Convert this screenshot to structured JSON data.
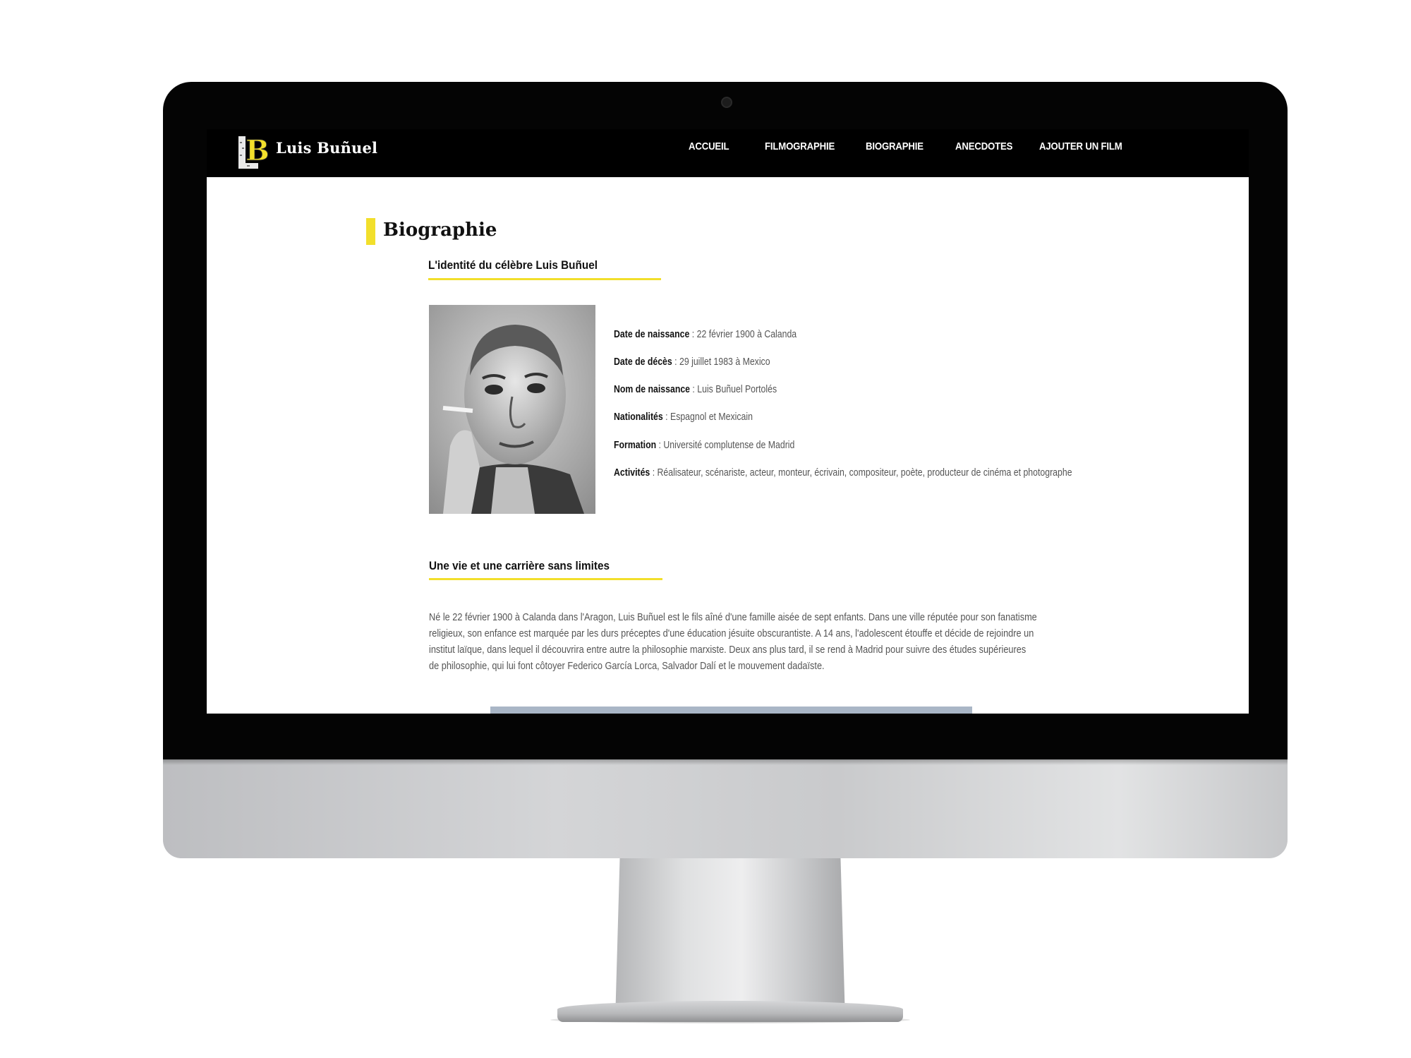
{
  "site": {
    "logo_letter": "B",
    "logo_text": "Luis Buñuel"
  },
  "nav": {
    "items": [
      "ACCUEIL",
      "FILMOGRAPHIE",
      "BIOGRAPHIE",
      "ANECDOTES",
      "AJOUTER UN FILM"
    ]
  },
  "page": {
    "title": "Biographie"
  },
  "identity": {
    "heading": "L'identité du célèbre Luis Buñuel",
    "facts": [
      {
        "label": "Date de naissance",
        "sep": " : ",
        "value": "22 février 1900 à Calanda"
      },
      {
        "label": "Date de décès",
        "sep": " : ",
        "value": "29 juillet 1983 à Mexico"
      },
      {
        "label": "Nom de naissance",
        "sep": " :  ",
        "value": "Luis Buñuel Portolés"
      },
      {
        "label": "Nationalités",
        "sep": " : ",
        "value": "Espagnol et Mexicain"
      },
      {
        "label": "Formation",
        "sep": " : ",
        "value": "Université complutense de Madrid"
      },
      {
        "label": "Activités",
        "sep": " : ",
        "value": "Réalisateur, scénariste, acteur, monteur, écrivain, compositeur, poète, producteur de cinéma et photographe"
      }
    ]
  },
  "career": {
    "heading": "Une vie et une carrière sans limites",
    "paragraph_lines": [
      "Né le 22 février 1900 à Calanda dans l'Aragon, Luis Buñuel est le fils aîné d'une famille aisée de sept enfants. Dans une ville réputée pour son fanatisme",
      "religieux, son enfance est marquée par les durs préceptes d'une éducation jésuite obscurantiste. A 14 ans, l'adolescent étouffe et décide de rejoindre un",
      "institut laïque, dans lequel il découvrira entre autre la philosophie marxiste. Deux ans plus tard, il se rend à Madrid pour suivre des études supérieures",
      "de philosophie, qui lui font côtoyer Federico García Lorca, Salvador Dalí et le mouvement dadaïste."
    ]
  },
  "colors": {
    "accent": "#f2df2b",
    "navbar": "#000000"
  },
  "icons": {
    "logo": "letter-b-logo-icon"
  }
}
